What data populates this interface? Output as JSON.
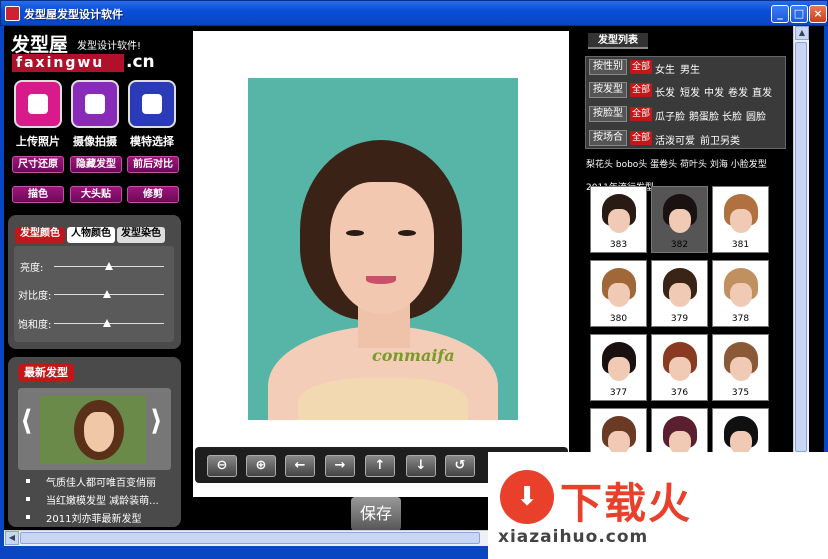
{
  "window": {
    "title": "发型屋发型设计软件",
    "min": "_",
    "max": "□",
    "close": "×"
  },
  "logo": {
    "name": "发型屋",
    "slogan": "发型设计软件!",
    "pinyin": "faxingwu",
    "tld": ".cn"
  },
  "actions": [
    {
      "label": "上传照片",
      "icon": "person-icon",
      "color": "#d81a8a"
    },
    {
      "label": "摄像拍摄",
      "icon": "camera-icon",
      "color": "#8a2ab8"
    },
    {
      "label": "模特选择",
      "icon": "people-icon",
      "color": "#2a3ab8"
    }
  ],
  "pills": {
    "row1": [
      "尺寸还原",
      "隐藏发型",
      "前后对比"
    ],
    "row2": [
      "描色",
      "大头贴",
      "修剪"
    ]
  },
  "color_panel": {
    "tabs": [
      "发型颜色",
      "人物颜色",
      "发型染色"
    ],
    "sliders": [
      {
        "label": "亮度:",
        "value": 0.5
      },
      {
        "label": "对比度:",
        "value": 0.48
      },
      {
        "label": "饱和度:",
        "value": 0.48
      }
    ]
  },
  "newest": {
    "title": "最新发型",
    "prev": "⟨",
    "next": "⟩",
    "items": [
      "气质佳人都可唯百变俏丽",
      "当红嫩模发型 减龄装萌...",
      "2011刘亦菲最新发型"
    ]
  },
  "photo": {
    "watermark": "conmaifa"
  },
  "tools": [
    "⊖",
    "⊕",
    "←",
    "→",
    "↑",
    "↓",
    "↺"
  ],
  "save_label": "保存",
  "hair_list": {
    "title": "发型列表",
    "rows": [
      {
        "label": "按性别",
        "all": "全部",
        "options": [
          "女生",
          "男生"
        ]
      },
      {
        "label": "按发型",
        "all": "全部",
        "options": [
          "长发",
          "短发",
          "中发",
          "卷发",
          "直发"
        ]
      },
      {
        "label": "按脸型",
        "all": "全部",
        "options": [
          "瓜子脸",
          "鹅蛋脸",
          "长脸",
          "圆脸"
        ]
      },
      {
        "label": "按场合",
        "all": "全部",
        "options": [
          "活泼可爱",
          "前卫另类"
        ]
      }
    ],
    "tags": "梨花头 bobo头 蛋卷头 荷叶头 刘海 小脸发型",
    "sub": "2011年流行发型",
    "thumbs": [
      {
        "num": "383",
        "hair": "#2a1a14"
      },
      {
        "num": "382",
        "hair": "#1a1210"
      },
      {
        "num": "381",
        "hair": "#b07040"
      },
      {
        "num": "380",
        "hair": "#a06838"
      },
      {
        "num": "379",
        "hair": "#3a2418"
      },
      {
        "num": "378",
        "hair": "#c09060"
      },
      {
        "num": "377",
        "hair": "#1a1010"
      },
      {
        "num": "376",
        "hair": "#8a3a20"
      },
      {
        "num": "375",
        "hair": "#8a5a38"
      },
      {
        "num": "",
        "hair": "#6a3a24"
      },
      {
        "num": "",
        "hair": "#5a2030"
      },
      {
        "num": "",
        "hair": "#101010"
      }
    ]
  },
  "scroll": {
    "up": "▲",
    "down": "▼",
    "left": "◀",
    "right": "▶"
  },
  "brand": {
    "logo": "⬇",
    "text": "下载火",
    "url": "xiazaihuo.com"
  }
}
